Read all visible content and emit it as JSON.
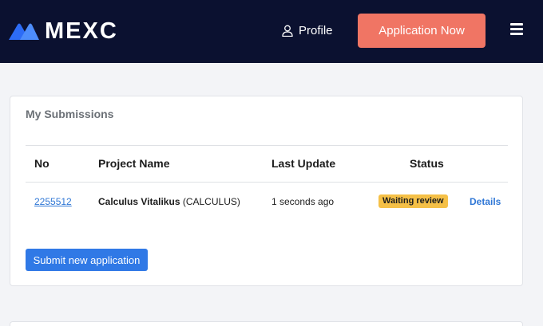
{
  "header": {
    "logo_text": "MEXC",
    "profile_label": "Profile",
    "apply_label": "Application Now"
  },
  "submissions": {
    "title": "My Submissions",
    "columns": [
      "No",
      "Project Name",
      "Last Update",
      "Status"
    ],
    "rows": [
      {
        "no": "2255512",
        "project_name": "Calculus Vitalikus",
        "project_symbol": "(CALCULUS)",
        "last_update": "1 seconds ago",
        "status": "Waiting review",
        "action": "Details"
      }
    ],
    "submit_label": "Submit new application"
  },
  "colors": {
    "navbar": "#0b1130",
    "apply_button": "#f07564",
    "primary_blue": "#3079e6",
    "status_waiting": "#f5c047"
  },
  "icons": [
    "mexc-logo-icon",
    "user-icon",
    "hamburger-menu-icon"
  ]
}
